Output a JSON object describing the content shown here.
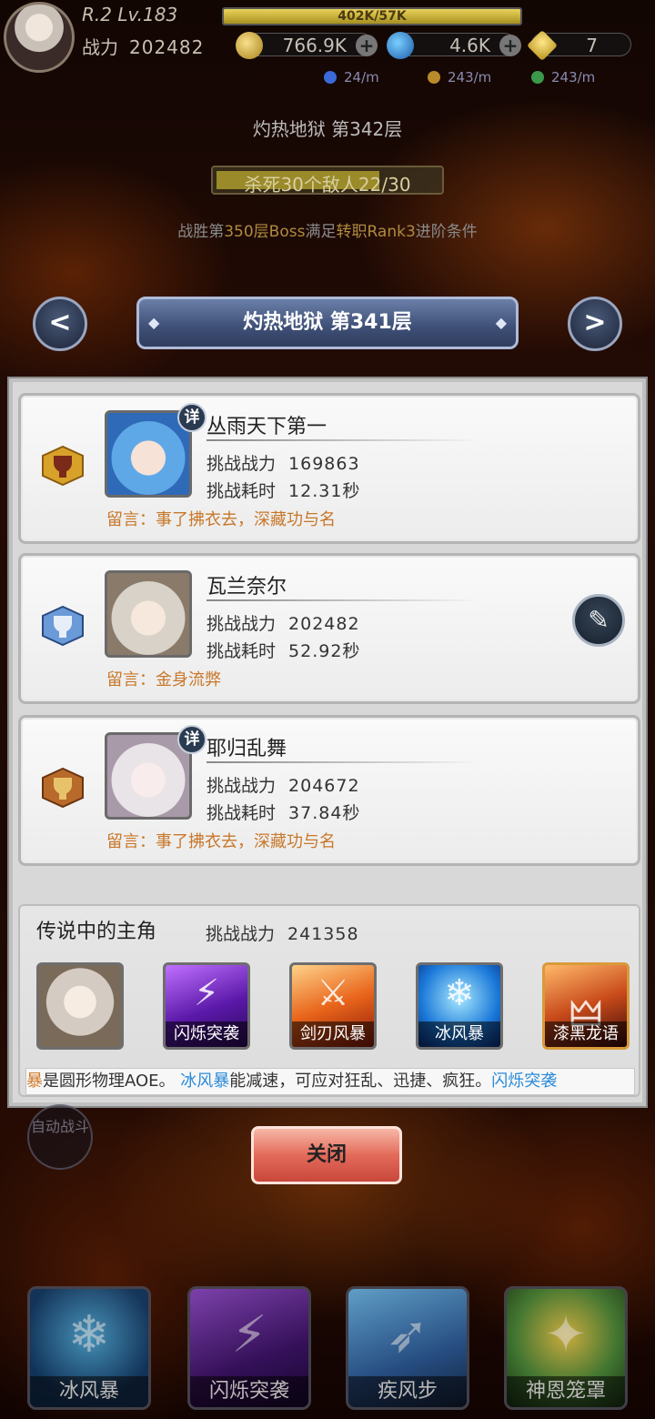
{
  "hud": {
    "rank_level": "R.2 Lv.183",
    "exp_text": "402K/57K",
    "exp_progress": 1.0,
    "power_label": "战力",
    "power_value": "202482",
    "gold": "766.9K",
    "gem": "4.6K",
    "crystal": "7",
    "rates": [
      "24/m",
      "243/m",
      "243/m"
    ]
  },
  "stage": {
    "current_floor": "灼热地狱 第342层",
    "kill_task": "杀死30个敌人22/30",
    "kill_progress": 0.733,
    "boss_condition_parts": [
      "战胜第",
      "350层Boss",
      "满足",
      "转职Rank3",
      "进阶条件"
    ]
  },
  "banner": {
    "title": "灼热地狱 第341层",
    "prev": "<",
    "next": ">"
  },
  "records": [
    {
      "name": "丛雨天下第一",
      "power_label": "挑战战力",
      "power": "169863",
      "time_label": "挑战耗时",
      "time": "12.31秒",
      "message": "留言：事了拂衣去，深藏功与名",
      "detail_badge": "详",
      "medal": "gold"
    },
    {
      "name": "瓦兰奈尔",
      "power_label": "挑战战力",
      "power": "202482",
      "time_label": "挑战耗时",
      "time": "52.92秒",
      "message": "留言：金身流弊",
      "medal": "silver"
    },
    {
      "name": "耶归乱舞",
      "power_label": "挑战战力",
      "power": "204672",
      "time_label": "挑战耗时",
      "time": "37.84秒",
      "message": "留言：事了拂衣去，深藏功与名",
      "detail_badge": "详",
      "medal": "bronze"
    }
  ],
  "legend": {
    "title": "传说中的主角",
    "power_label": "挑战战力",
    "power": "241358",
    "skills": [
      "闪烁突袭",
      "剑刃风暴",
      "冰风暴",
      "漆黑龙语"
    ],
    "tip_parts": [
      "暴",
      "是圆形物理AOE。 ",
      "冰风暴",
      "能减速，可应对狂乱、迅捷、疯狂。",
      "闪烁突袭"
    ]
  },
  "close_label": "关闭",
  "auto_battle": "自动战斗",
  "bottom_skills": [
    "冰风暴",
    "闪烁突袭",
    "疾风步",
    "神恩笼罩"
  ],
  "colors": {
    "message_orange": "#c8782a",
    "tip_blue": "#2a8ad8",
    "close_button": "#e36a5a"
  }
}
